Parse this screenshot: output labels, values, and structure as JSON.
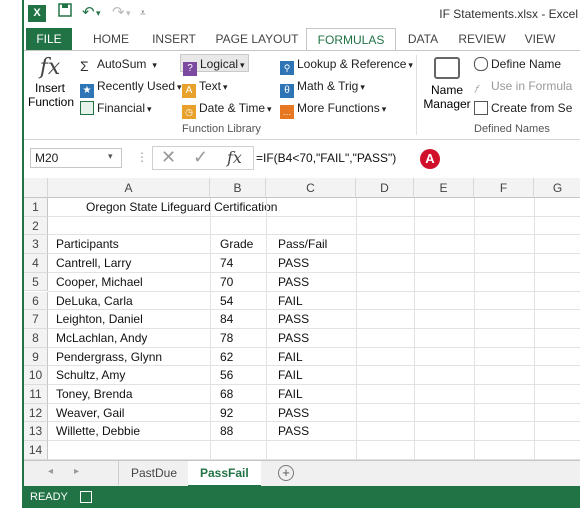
{
  "window": {
    "title": "IF Statements.xlsx - Excel"
  },
  "quick_access": {
    "undo": "↶",
    "redo": "↷"
  },
  "ribbon_tabs": [
    "FILE",
    "HOME",
    "INSERT",
    "PAGE LAYOUT",
    "FORMULAS",
    "DATA",
    "REVIEW",
    "VIEW"
  ],
  "ribbon": {
    "insert_function": [
      "Insert",
      "Function"
    ],
    "autosum": "AutoSum",
    "recently_used": "Recently Used",
    "financial": "Financial",
    "logical": "Logical",
    "text": "Text",
    "date_time": "Date & Time",
    "lookup": "Lookup & Reference",
    "math_trig": "Math & Trig",
    "more_functions": "More Functions",
    "function_library_label": "Function Library",
    "name_manager": [
      "Name",
      "Manager"
    ],
    "define_name": "Define Name",
    "use_in_formula": "Use in Formula",
    "create_from_sel": "Create from Se",
    "defined_names_label": "Defined Names"
  },
  "formula_bar": {
    "name_box": "M20",
    "formula": "=IF(B4<70,\"FAIL\",\"PASS\")",
    "marker": "A"
  },
  "columns": [
    "A",
    "B",
    "C",
    "D",
    "E",
    "F",
    "G"
  ],
  "rows": [
    {
      "n": "1",
      "a": "Oregon State Lifeguard Certification",
      "b": "",
      "c": ""
    },
    {
      "n": "2",
      "a": "",
      "b": "",
      "c": ""
    },
    {
      "n": "3",
      "a": "Participants",
      "b": "Grade",
      "c": "Pass/Fail"
    },
    {
      "n": "4",
      "a": "Cantrell, Larry",
      "b": "74",
      "c": "PASS"
    },
    {
      "n": "5",
      "a": "Cooper, Michael",
      "b": "70",
      "c": "PASS"
    },
    {
      "n": "6",
      "a": "DeLuka, Carla",
      "b": "54",
      "c": "FAIL"
    },
    {
      "n": "7",
      "a": "Leighton, Daniel",
      "b": "84",
      "c": "PASS"
    },
    {
      "n": "8",
      "a": "McLachlan, Andy",
      "b": "78",
      "c": "PASS"
    },
    {
      "n": "9",
      "a": "Pendergrass, Glynn",
      "b": "62",
      "c": "FAIL"
    },
    {
      "n": "10",
      "a": "Schultz, Amy",
      "b": "56",
      "c": "FAIL"
    },
    {
      "n": "11",
      "a": "Toney, Brenda",
      "b": "68",
      "c": "FAIL"
    },
    {
      "n": "12",
      "a": "Weaver, Gail",
      "b": "92",
      "c": "PASS"
    },
    {
      "n": "13",
      "a": "Willette, Debbie",
      "b": "88",
      "c": "PASS"
    },
    {
      "n": "14",
      "a": "",
      "b": "",
      "c": ""
    }
  ],
  "sheet_tabs": [
    "PastDue",
    "PassFail"
  ],
  "status": {
    "ready": "READY"
  },
  "colors": {
    "accent": "#217346",
    "marker": "#d0102a"
  }
}
